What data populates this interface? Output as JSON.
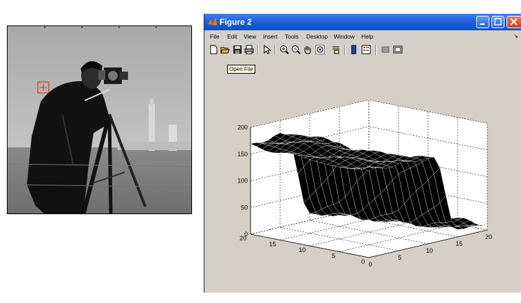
{
  "figure": {
    "title": "Figure 2",
    "menu": [
      "File",
      "Edit",
      "View",
      "Insert",
      "Tools",
      "Desktop",
      "Window",
      "Help"
    ],
    "tooltip": "Open File"
  },
  "toolbar": {
    "icons": [
      "new-figure-icon",
      "open-file-icon",
      "save-icon",
      "print-icon",
      "edit-plot-arrow-icon",
      "zoom-in-icon",
      "zoom-out-icon",
      "pan-hand-icon",
      "rotate-3d-icon",
      "data-cursor-icon",
      "colorbar-icon",
      "legend-icon",
      "hide-plot-tools-icon",
      "show-plot-tools-icon"
    ]
  },
  "left_image": {
    "description_icon": "cameraman-photo",
    "marker_color": "#e03020"
  },
  "chart_data": {
    "type": "surface",
    "z_ticks": [
      "0",
      "50",
      "100",
      "150",
      "200"
    ],
    "x_ticks": [
      "0",
      "5",
      "10",
      "15",
      "20"
    ],
    "y_ticks": [
      "0",
      "5",
      "10",
      "15",
      "20"
    ],
    "zlim": [
      0,
      200
    ],
    "xlim": [
      0,
      20
    ],
    "ylim": [
      0,
      20
    ],
    "grid": true,
    "surface_color": "#000000",
    "mesh_color": "#ffffff",
    "surface_high_value": 160,
    "surface_low_value": 10
  }
}
